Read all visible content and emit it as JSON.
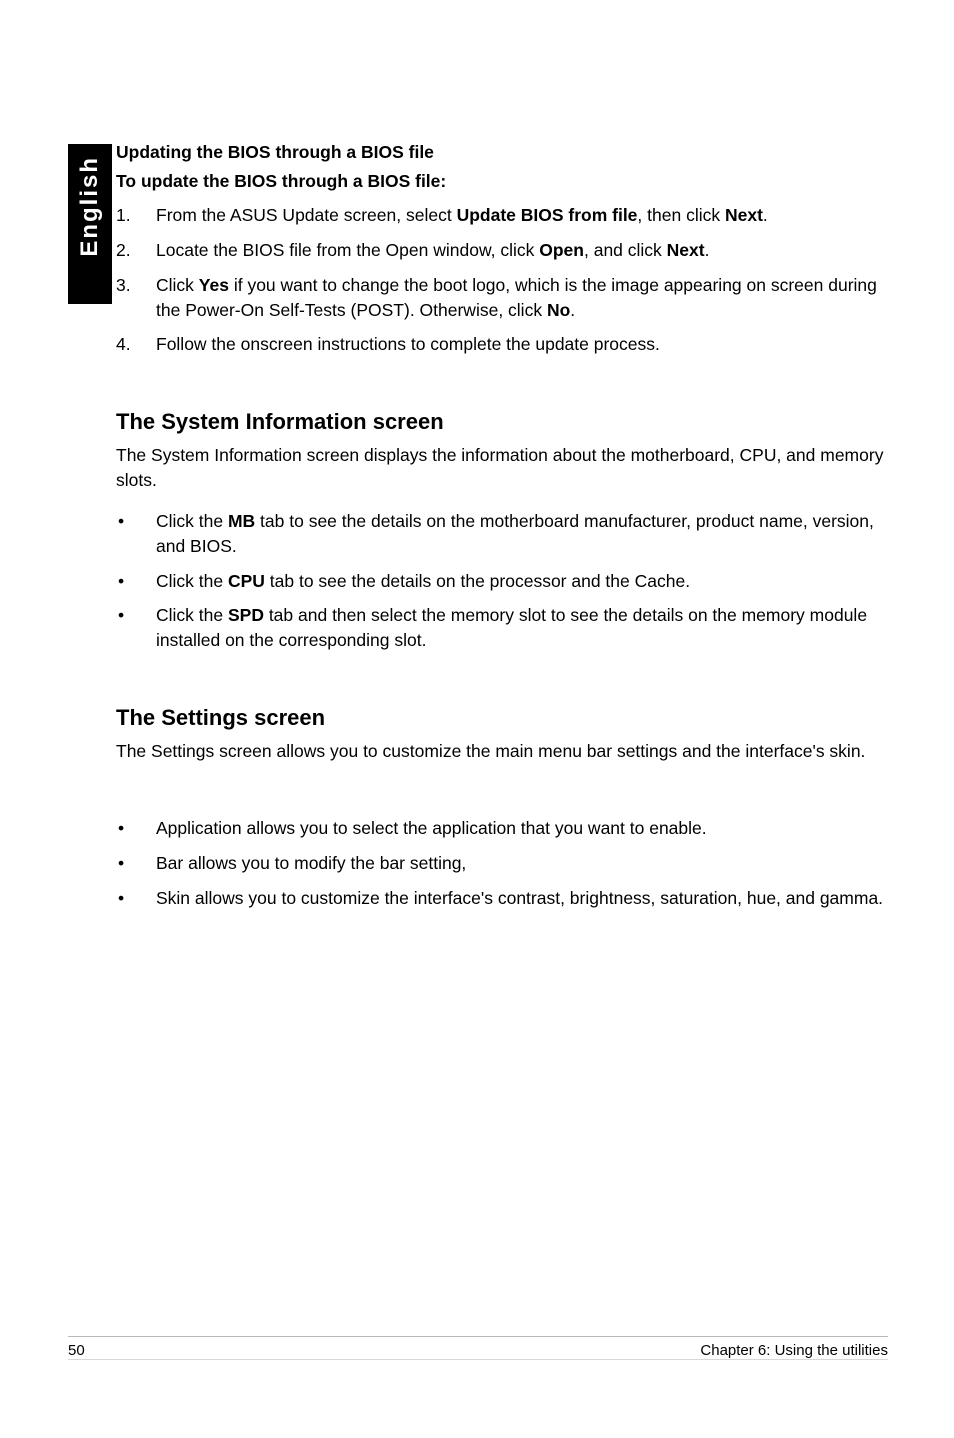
{
  "sideTab": "English",
  "section1": {
    "head1": "Updating the BIOS through a BIOS file",
    "head2": "To update the BIOS through a BIOS file:",
    "steps": [
      {
        "n": "1.",
        "pre": "From the ASUS Update screen, select ",
        "b1": "Update BIOS from file",
        "mid": ", then click ",
        "b2": "Next",
        "post": "."
      },
      {
        "n": "2.",
        "pre": "Locate the BIOS file from the Open window, click ",
        "b1": "Open",
        "mid": ", and click ",
        "b2": "Next",
        "post": "."
      },
      {
        "n": "3.",
        "pre": "Click ",
        "b1": "Yes",
        "mid": " if you want to change the boot logo, which is the image appearing on screen during the Power-On Self-Tests (POST). Otherwise, click ",
        "b2": "No",
        "post": "."
      },
      {
        "n": "4.",
        "pre": "Follow the onscreen instructions to complete the update process.",
        "b1": "",
        "mid": "",
        "b2": "",
        "post": ""
      }
    ]
  },
  "section2": {
    "title": "The System Information screen",
    "para": "The System Information screen displays the information about the motherboard, CPU, and memory slots.",
    "bullets": [
      {
        "pre": "Click the ",
        "b": "MB",
        "post": " tab to see the details on the motherboard manufacturer, product name, version, and BIOS."
      },
      {
        "pre": "Click the ",
        "b": "CPU",
        "post": " tab to see the details on the processor and the Cache."
      },
      {
        "pre": "Click the ",
        "b": "SPD",
        "post": " tab and then select the memory slot to see the details on the memory module installed on the corresponding slot."
      }
    ]
  },
  "section3": {
    "title": "The Settings screen",
    "para": "The Settings screen allows you to customize the main menu bar settings and the interface's skin.",
    "bullets": [
      {
        "text": "Application allows you to select the application that you want to enable."
      },
      {
        "text": "Bar allows you to modify the bar setting,"
      },
      {
        "text": "Skin allows you to customize the interface's contrast, brightness, saturation, hue, and gamma."
      }
    ]
  },
  "footer": {
    "pageNum": "50",
    "chapter": "Chapter 6: Using the utilities"
  }
}
